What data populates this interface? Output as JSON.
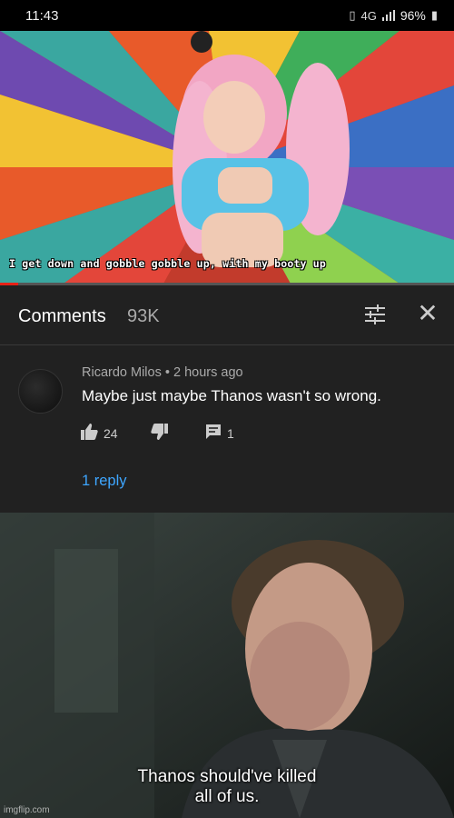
{
  "status_bar": {
    "time": "11:43",
    "network": "4G",
    "battery": "96%",
    "icons": [
      "vibrate-icon",
      "signal-icon",
      "battery-icon"
    ]
  },
  "video": {
    "caption": "I get down and gobble gobble up, with my booty up"
  },
  "comments": {
    "title": "Comments",
    "count": "93K",
    "icons": [
      "filter-icon",
      "close-icon"
    ]
  },
  "comment": {
    "author": "Ricardo Milos",
    "separator": " • ",
    "age": "2 hours ago",
    "text": "Maybe just maybe Thanos wasn't so wrong.",
    "likes": "24",
    "replies_count": "1",
    "reply_link": "1 reply",
    "icons": [
      "thumbs-up-icon",
      "thumbs-down-icon",
      "reply-icon"
    ]
  },
  "meme": {
    "caption_line1": "Thanos should've killed",
    "caption_line2": "all of us.",
    "watermark": "imgflip.com"
  },
  "colors": {
    "panel_bg": "#212121",
    "link": "#3ea6ff",
    "progress": "#e62117"
  }
}
